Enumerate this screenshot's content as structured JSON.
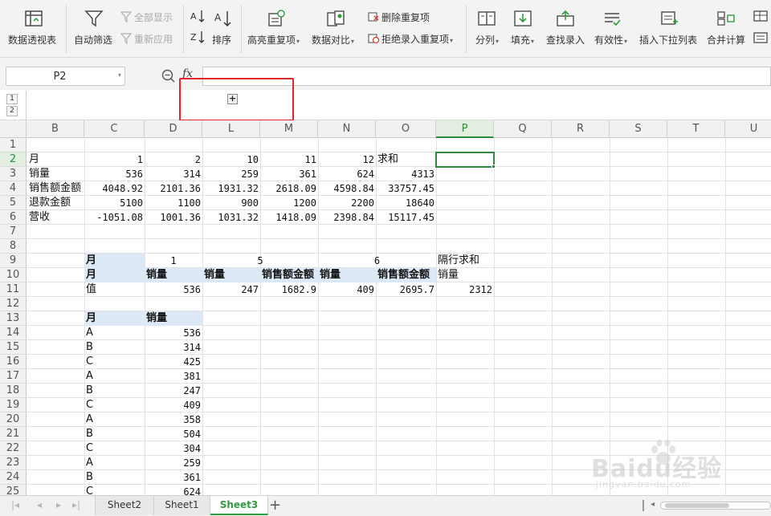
{
  "ribbon": {
    "pivot": "数据透视表",
    "autofilter": "自动筛选",
    "show_all": "全部显示",
    "reapply": "重新应用",
    "sort": "排序",
    "highlight_dup": "高亮重复项",
    "data_compare": "数据对比",
    "delete_dup": "删除重复项",
    "reject_dup": "拒绝录入重复项",
    "split_col": "分列",
    "fill": "填充",
    "find_entry": "查找录入",
    "validity": "有效性",
    "insert_dropdown": "插入下拉列表",
    "consolidate": "合并计算"
  },
  "formula_bar": {
    "name_box": "P2",
    "fx": "fx",
    "formula": ""
  },
  "outline": {
    "levels": [
      "1",
      "2"
    ],
    "expand_button": "+"
  },
  "columns": [
    "B",
    "C",
    "D",
    "L",
    "M",
    "N",
    "O",
    "P",
    "Q",
    "R",
    "S",
    "T",
    "U"
  ],
  "selected_column": "P",
  "rows": [
    "1",
    "2",
    "3",
    "4",
    "5",
    "6",
    "7",
    "8",
    "9",
    "10",
    "11",
    "12",
    "13",
    "14",
    "15",
    "16",
    "17",
    "18",
    "19",
    "20",
    "21",
    "22",
    "23",
    "24",
    "25"
  ],
  "selected_row": "2",
  "cells": {
    "r2": {
      "B": "月",
      "C": "1",
      "D": "2",
      "L": "10",
      "M": "11",
      "N": "12",
      "O": "求和"
    },
    "r3": {
      "B": "销量",
      "C": "536",
      "D": "314",
      "L": "259",
      "M": "361",
      "N": "624",
      "O": "4313"
    },
    "r4": {
      "B": "销售额金额",
      "C": "4048.92",
      "D": "2101.36",
      "L": "1931.32",
      "M": "2618.09",
      "N": "4598.84",
      "O": "33757.45"
    },
    "r5": {
      "B": "退款金额",
      "C": "5100",
      "D": "1100",
      "L": "900",
      "M": "1200",
      "N": "2200",
      "O": "18640"
    },
    "r6": {
      "B": "营收",
      "C": "-1051.08",
      "D": "1001.36",
      "L": "1031.32",
      "M": "1418.09",
      "N": "2398.84",
      "O": "15117.45"
    },
    "r9": {
      "C": "月",
      "D": "1",
      "LM": "5",
      "NO": "6",
      "P": "隔行求和"
    },
    "r10": {
      "C": "月",
      "D": "销量",
      "L": "销量",
      "M": "销售额金额",
      "N": "销量",
      "O": "销售额金额",
      "P": "销量"
    },
    "r11": {
      "C": "值",
      "D": "536",
      "L": "247",
      "M": "1682.9",
      "N": "409",
      "O": "2695.7",
      "P": "2312"
    },
    "r13": {
      "C": "月",
      "D": "销量"
    },
    "list": [
      {
        "m": "A",
        "v": "536"
      },
      {
        "m": "B",
        "v": "314"
      },
      {
        "m": "C",
        "v": "425"
      },
      {
        "m": "A",
        "v": "381"
      },
      {
        "m": "B",
        "v": "247"
      },
      {
        "m": "C",
        "v": "409"
      },
      {
        "m": "A",
        "v": "358"
      },
      {
        "m": "B",
        "v": "504"
      },
      {
        "m": "C",
        "v": "304"
      },
      {
        "m": "A",
        "v": "259"
      },
      {
        "m": "B",
        "v": "361"
      },
      {
        "m": "C",
        "v": "624"
      }
    ]
  },
  "sheets": [
    "Sheet2",
    "Sheet1",
    "Sheet3"
  ],
  "active_sheet": "Sheet3",
  "watermark": {
    "brand": "Baidu经验",
    "url": "jingyan.baidu.com"
  },
  "colors": {
    "accent_green": "#2e9b3f",
    "highlight_blue": "#dde9f6",
    "annotation_red": "#e0262b"
  }
}
